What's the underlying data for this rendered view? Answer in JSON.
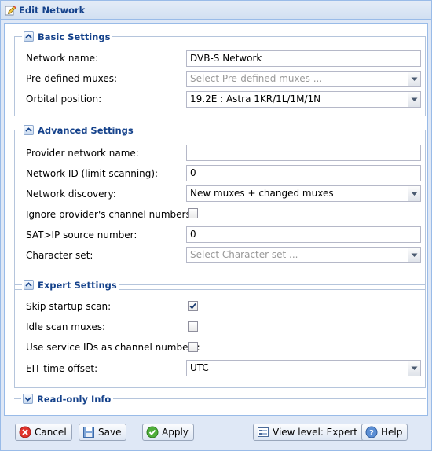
{
  "window": {
    "title": "Edit Network"
  },
  "basic": {
    "legend": "Basic Settings",
    "network_name_label": "Network name:",
    "network_name_value": "DVB-S Network",
    "predefined_label": "Pre-defined muxes:",
    "predefined_placeholder": "Select Pre-defined muxes ...",
    "orbital_label": "Orbital position:",
    "orbital_value": "19.2E : Astra 1KR/1L/1M/1N"
  },
  "advanced": {
    "legend": "Advanced Settings",
    "provider_label": "Provider network name:",
    "provider_value": "",
    "network_id_label": "Network ID (limit scanning):",
    "network_id_value": "0",
    "discovery_label": "Network discovery:",
    "discovery_value": "New muxes + changed muxes",
    "ignore_label": "Ignore provider's channel numbers:",
    "ignore_checked": false,
    "satip_label": "SAT>IP source number:",
    "satip_value": "0",
    "charset_label": "Character set:",
    "charset_placeholder": "Select Character set ..."
  },
  "expert": {
    "legend": "Expert Settings",
    "skip_label": "Skip startup scan:",
    "skip_checked": true,
    "idle_label": "Idle scan muxes:",
    "idle_checked": false,
    "service_ids_label": "Use service IDs as channel numbers:",
    "service_ids_checked": false,
    "eit_label": "EIT time offset:",
    "eit_value": "UTC"
  },
  "readonly": {
    "legend": "Read-only Info"
  },
  "buttons": {
    "cancel": "Cancel",
    "save": "Save",
    "apply": "Apply",
    "view_level": "View level: Expert",
    "help": "Help"
  },
  "colors": {
    "accent": "#15428b",
    "border": "#99bbe8",
    "background": "#dfe8f6"
  },
  "icons": {
    "title": "pencil-edit-icon",
    "cancel": "cancel-icon",
    "save": "save-icon",
    "apply": "apply-check-icon",
    "view_level": "view-level-icon",
    "help": "help-icon"
  }
}
